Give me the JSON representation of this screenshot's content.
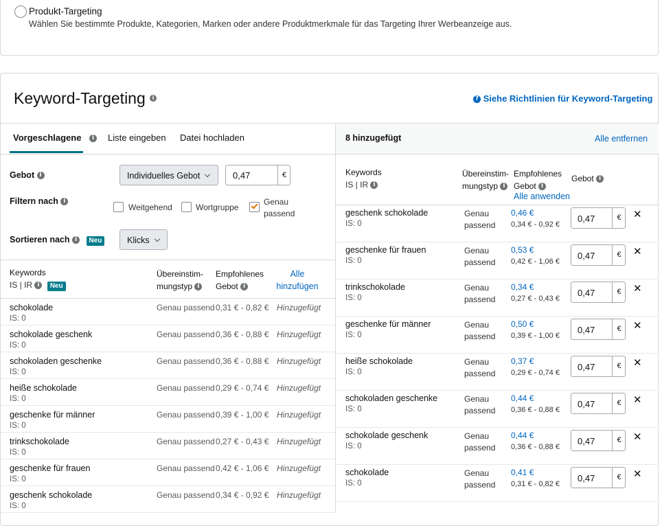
{
  "product_targeting": {
    "title": "Produkt-Targeting",
    "description": "Wählen Sie bestimmte Produkte, Kategorien, Marken oder andere Produktmerkmale für das Targeting Ihrer Werbeanzeige aus."
  },
  "keyword_targeting": {
    "title": "Keyword-Targeting",
    "guidelines_link": "Siehe Richtlinien für Keyword-Targeting"
  },
  "tabs": [
    {
      "label": "Vorgeschlagene",
      "active": true
    },
    {
      "label": "Liste eingeben",
      "active": false
    },
    {
      "label": "Datei hochladen",
      "active": false
    }
  ],
  "controls": {
    "gebot_label": "Gebot",
    "gebot_select": "Individuelles Gebot",
    "gebot_value": "0,47",
    "currency": "€",
    "filter_label": "Filtern nach",
    "filters": [
      {
        "label": "Weitgehend",
        "checked": false
      },
      {
        "label": "Wortgruppe",
        "checked": false
      },
      {
        "label": "Genau passend",
        "checked": true
      }
    ],
    "sort_label": "Sortieren nach",
    "new_badge": "Neu",
    "sort_select": "Klicks"
  },
  "left_table": {
    "headers": {
      "keywords": "Keywords",
      "is_ir": "IS | IR",
      "new_badge": "Neu",
      "match_type": "Übereinstim-mungstyp",
      "match_type_1": "Übereinstim-",
      "match_type_2": "mungstyp",
      "bid_1": "Empfohlenes",
      "bid_2": "Gebot",
      "add_all_1": "Alle",
      "add_all_2": "hinzufügen"
    },
    "rows": [
      {
        "keyword": "schokolade",
        "is": "IS: 0",
        "match": "Genau passend",
        "range": "0,31 € - 0,82 €",
        "status": "Hinzugefügt"
      },
      {
        "keyword": "schokolade geschenk",
        "is": "IS: 0",
        "match": "Genau passend",
        "range": "0,36 € - 0,88 €",
        "status": "Hinzugefügt"
      },
      {
        "keyword": "schokoladen geschenke",
        "is": "IS: 0",
        "match": "Genau passend",
        "range": "0,36 € - 0,88 €",
        "status": "Hinzugefügt"
      },
      {
        "keyword": "heiße schokolade",
        "is": "IS: 0",
        "match": "Genau passend",
        "range": "0,29 € - 0,74 €",
        "status": "Hinzugefügt"
      },
      {
        "keyword": "geschenke für männer",
        "is": "IS: 0",
        "match": "Genau passend",
        "range": "0,39 € - 1,00 €",
        "status": "Hinzugefügt"
      },
      {
        "keyword": "trinkschokolade",
        "is": "IS: 0",
        "match": "Genau passend",
        "range": "0,27 € - 0,43 €",
        "status": "Hinzugefügt"
      },
      {
        "keyword": "geschenke für frauen",
        "is": "IS: 0",
        "match": "Genau passend",
        "range": "0,42 € - 1,06 €",
        "status": "Hinzugefügt"
      },
      {
        "keyword": "geschenk schokolade",
        "is": "IS: 0",
        "match": "Genau passend",
        "range": "0,34 € - 0,92 €",
        "status": "Hinzugefügt"
      }
    ]
  },
  "right_panel": {
    "added_count": "8 hinzugefügt",
    "remove_all": "Alle entfernen",
    "headers": {
      "keywords": "Keywords",
      "is_ir": "IS | IR",
      "match_1": "Übereinstim-",
      "match_2": "mungstyp",
      "bid_1": "Empfohlenes",
      "bid_2": "Gebot",
      "apply_all": "Alle anwenden",
      "gebot": "Gebot"
    },
    "rows": [
      {
        "keyword": "geschenk schokolade",
        "is": "IS: 0",
        "match_1": "Genau",
        "match_2": "passend",
        "suggested": "0,46 €",
        "range": "0,34 € - 0,92 €",
        "bid": "0,47"
      },
      {
        "keyword": "geschenke für frauen",
        "is": "IS: 0",
        "match_1": "Genau",
        "match_2": "passend",
        "suggested": "0,53 €",
        "range": "0,42 € - 1,06 €",
        "bid": "0,47"
      },
      {
        "keyword": "trinkschokolade",
        "is": "IS: 0",
        "match_1": "Genau",
        "match_2": "passend",
        "suggested": "0,34 €",
        "range": "0,27 € - 0,43 €",
        "bid": "0,47"
      },
      {
        "keyword": "geschenke für männer",
        "is": "IS: 0",
        "match_1": "Genau",
        "match_2": "passend",
        "suggested": "0,50 €",
        "range": "0,39 € - 1,00 €",
        "bid": "0,47"
      },
      {
        "keyword": "heiße schokolade",
        "is": "IS: 0",
        "match_1": "Genau",
        "match_2": "passend",
        "suggested": "0,37 €",
        "range": "0,29 € - 0,74 €",
        "bid": "0,47"
      },
      {
        "keyword": "schokoladen geschenke",
        "is": "IS: 0",
        "match_1": "Genau",
        "match_2": "passend",
        "suggested": "0,44 €",
        "range": "0,36 € - 0,88 €",
        "bid": "0,47"
      },
      {
        "keyword": "schokolade geschenk",
        "is": "IS: 0",
        "match_1": "Genau",
        "match_2": "passend",
        "suggested": "0,44 €",
        "range": "0,36 € - 0,88 €",
        "bid": "0,47"
      },
      {
        "keyword": "schokolade",
        "is": "IS: 0",
        "match_1": "Genau",
        "match_2": "passend",
        "suggested": "0,41 €",
        "range": "0,31 € - 0,82 €",
        "bid": "0,47"
      }
    ]
  },
  "colors": {
    "link": "#0066c0",
    "badge": "#067d8d",
    "tab_underline": "#007185",
    "border": "#d5d9d9"
  }
}
